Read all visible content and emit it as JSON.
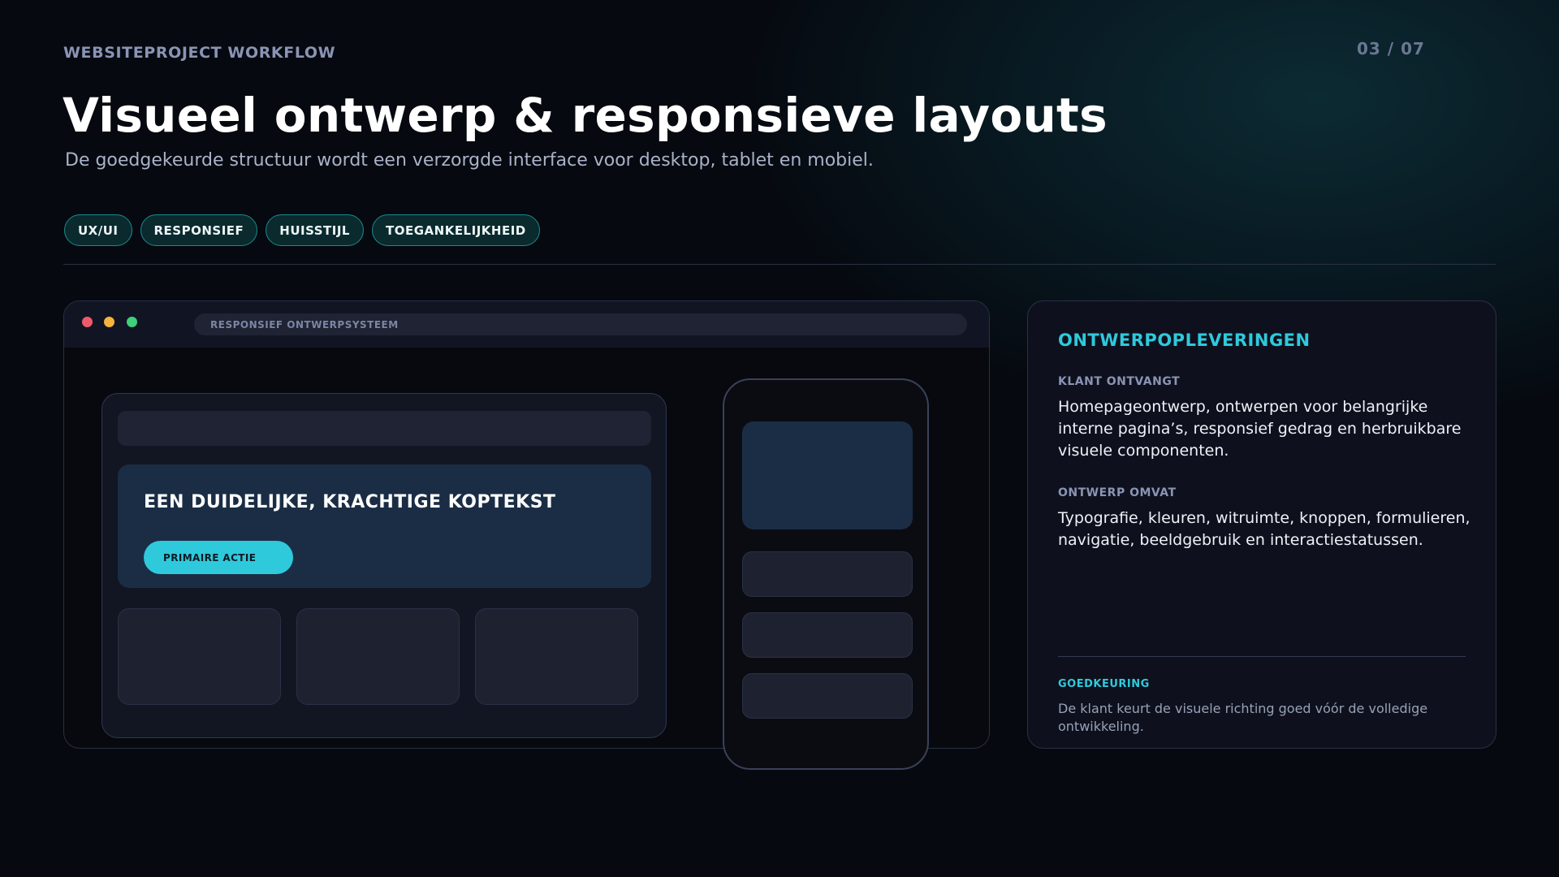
{
  "header": {
    "kicker": "WEBSITEPROJECT WORKFLOW",
    "page_number": "03 / 07",
    "title": "Visueel ontwerp & responsieve layouts",
    "subtitle": "De goedgekeurde structuur wordt een verzorgde interface voor desktop, tablet en mobiel."
  },
  "tags": [
    "UX/UI",
    "RESPONSIEF",
    "HUISSTIJL",
    "TOEGANKELIJKHEID"
  ],
  "mockup": {
    "url_label": "RESPONSIEF ONTWERPSYSTEEM",
    "hero_heading": "EEN DUIDELIJKE, KRACHTIGE KOPTEKST",
    "cta_label": "PRIMAIRE ACTIE",
    "window_dots": [
      "#ef5a6a",
      "#f6b33d",
      "#3ed07a"
    ]
  },
  "panel": {
    "title": "ONTWERPOPLEVERINGEN",
    "sections": [
      {
        "label": "KLANT ONTVANGT",
        "text": "Homepageontwerp, ontwerpen voor belangrijke interne pagina’s, responsief gedrag en herbruikbare visuele componenten."
      },
      {
        "label": "ONTWERP OMVAT",
        "text": "Typografie, kleuren, witruimte, knoppen, formulieren, navigatie, beeldgebruik en interactiestatussen."
      }
    ],
    "approval_label": "GOEDKEURING",
    "approval_text": "De klant keurt de visuele richting goed vóór de volledige ontwikkeling."
  },
  "colors": {
    "accent": "#2fc9dc",
    "background": "#05080d",
    "panel": "#0e111d",
    "hero_block": "#1b2d45"
  }
}
